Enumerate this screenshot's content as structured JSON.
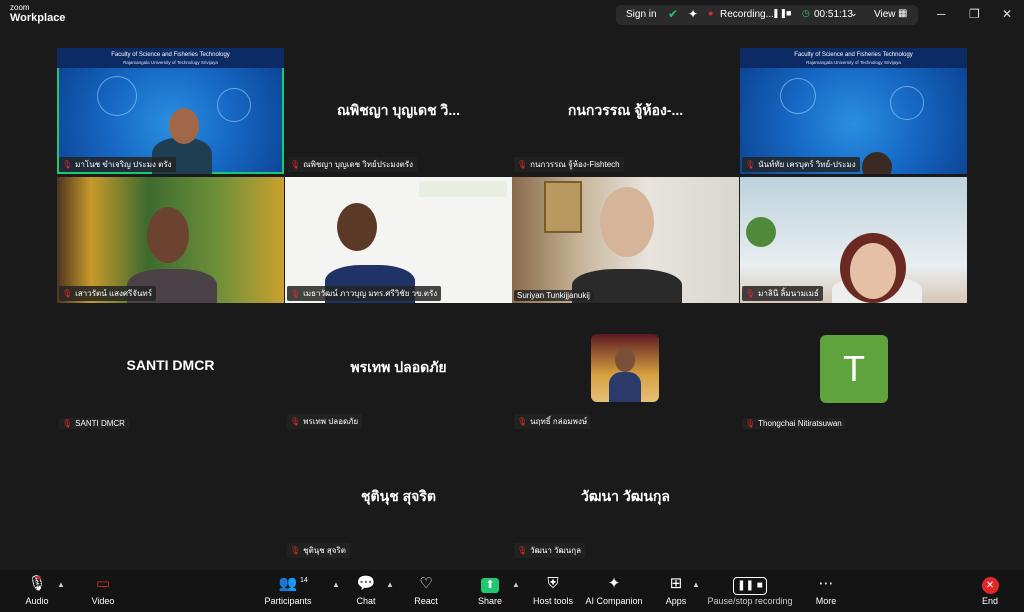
{
  "app": {
    "brand_small": "zoom",
    "brand_large": "Workplace"
  },
  "titlebar": {
    "sign_in": "Sign in",
    "recording": "Recording...",
    "timer": "00:51:13",
    "view": "View"
  },
  "banner": {
    "title": "Faculty of Science and Fisheries Technology",
    "subtitle": "Rajamangala University of Technology Srivijaya"
  },
  "participants": [
    {
      "display": "",
      "label": "มาโนช ขำเจริญ ประมง ตรัง"
    },
    {
      "display": "ณพิชญา บุญเดช วิ...",
      "label": "ณพิชญา บุญเดช วิทย์ประมงตรัง"
    },
    {
      "display": "กนกวรรณ จู้ห้อง-...",
      "label": "กนกวรรณ จู้ห้อง-Fishtech"
    },
    {
      "display": "",
      "label": "นันท์ทัย เครบุตร์ วิทย์-ประมง"
    },
    {
      "display": "",
      "label": "เสาวรัตน์ แสงศรีจันทร์"
    },
    {
      "display": "",
      "label": "เมธาวัฒน์ ภาวบุญ มทร.ศรีวิชัย วข.ตรัง"
    },
    {
      "display": "",
      "label": "Suriyan Tunkijjanukij"
    },
    {
      "display": "",
      "label": "มาลินี ลิ้มนามเมธ์"
    },
    {
      "display": "SANTI DMCR",
      "label": "SANTI DMCR"
    },
    {
      "display": "พรเทพ ปลอดภัย",
      "label": "พรเทพ ปลอดภัย"
    },
    {
      "display": "",
      "label": "นฤทธิ์ กล่อมพงษ์"
    },
    {
      "display": "",
      "avatar_letter": "T",
      "label": "Thongchai Nitiratsuwan"
    },
    {
      "display": "ชุตินุช สุจริต",
      "label": "ชุตินุช สุจริต"
    },
    {
      "display": "วัฒนา วัฒนกุล",
      "label": "วัฒนา วัฒนกุล"
    }
  ],
  "toolbar": {
    "audio": "Audio",
    "video": "Video",
    "participants": "Participants",
    "participants_count": "14",
    "chat": "Chat",
    "react": "React",
    "share": "Share",
    "host_tools": "Host tools",
    "ai_companion": "AI Companion",
    "apps": "Apps",
    "pause_stop_recording": "Pause/stop recording",
    "more": "More",
    "end": "End"
  },
  "colors": {
    "accent_green": "#1ec871",
    "share_green": "#1ec871",
    "end_red": "#e02828",
    "avatar_T": "#5ea33b"
  }
}
